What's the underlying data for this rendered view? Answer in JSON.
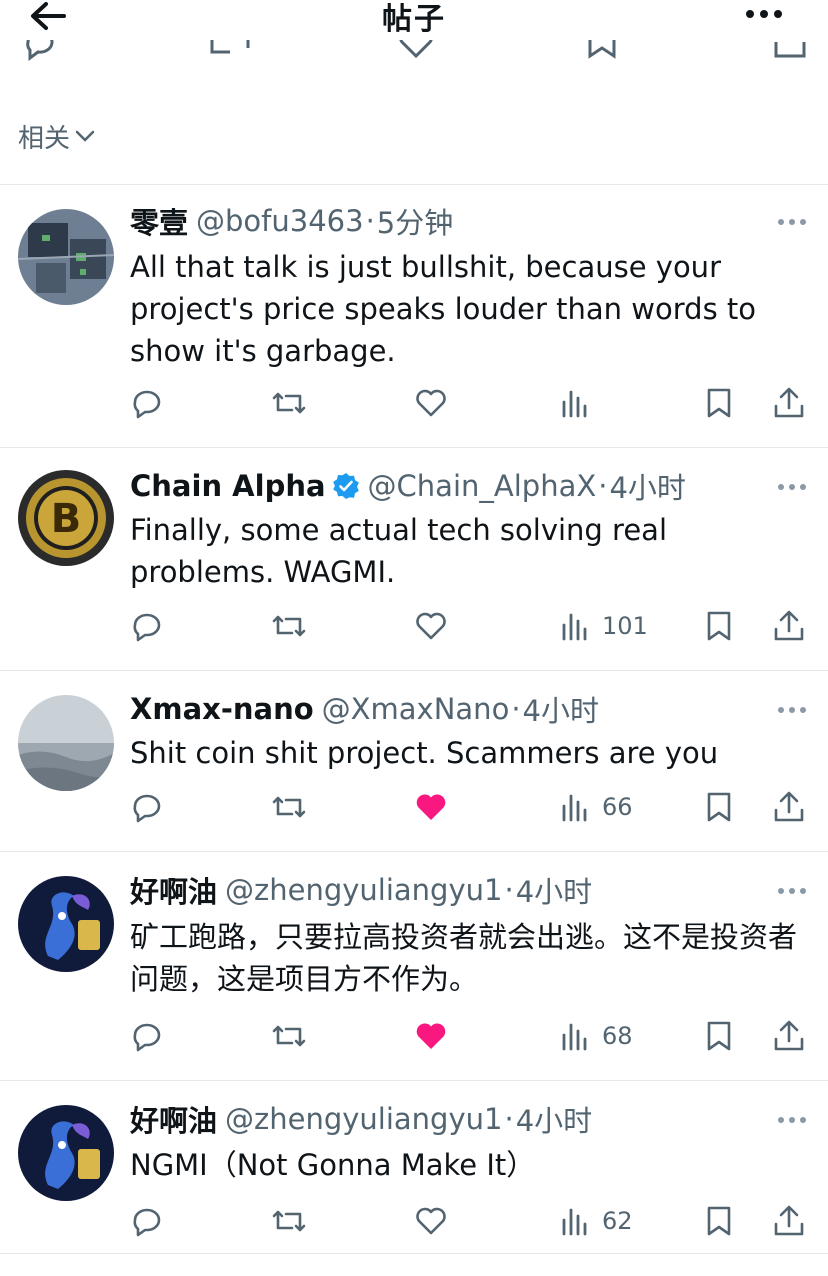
{
  "header": {
    "title": "帖子"
  },
  "related": {
    "label": "相关"
  },
  "colors": {
    "like_active": "#f91880",
    "verified": "#1d9bf0",
    "secondary": "#536471"
  },
  "tweets": [
    {
      "name": "零壹",
      "handle": "@bofu3463",
      "sep": "·",
      "time": "5分钟",
      "verified": false,
      "text": "All that talk is just bullshit, because your project's price speaks louder than words to show it's garbage.",
      "views": "",
      "liked": false
    },
    {
      "name": "Chain Alpha",
      "handle": "@Chain_AlphaX",
      "sep": "·",
      "time": "4小时",
      "verified": true,
      "text": "Finally, some actual tech solving real problems. WAGMI.",
      "views": "101",
      "liked": false
    },
    {
      "name": "Xmax-nano",
      "handle": "@XmaxNano",
      "sep": "·",
      "time": "4小时",
      "verified": false,
      "text": "Shit coin shit project. Scammers are you",
      "views": "66",
      "liked": true
    },
    {
      "name": "好啊油",
      "handle": "@zhengyuliangyu1",
      "sep": "·",
      "time": "4小时",
      "verified": false,
      "text": "矿工跑路，只要拉高投资者就会出逃。这不是投资者问题，这是项目方不作为。",
      "views": "68",
      "liked": true
    },
    {
      "name": "好啊油",
      "handle": "@zhengyuliangyu1",
      "sep": "·",
      "time": "4小时",
      "verified": false,
      "text": "NGMI（Not Gonna Make It）",
      "views": "62",
      "liked": false
    }
  ]
}
